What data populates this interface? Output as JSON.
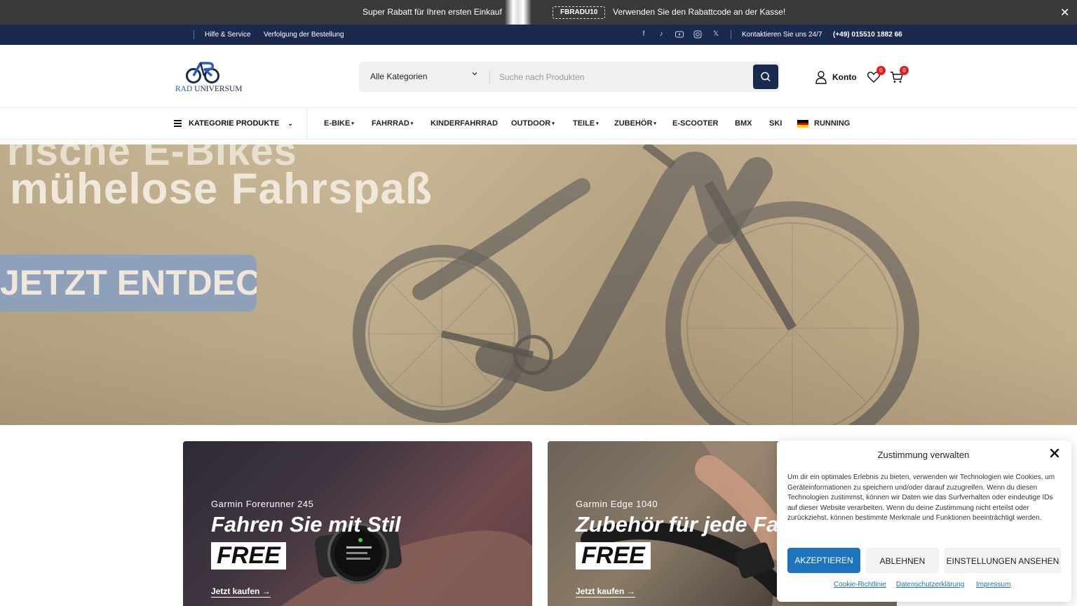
{
  "promo_bar": {
    "text_left": "Super Rabatt für Ihren ersten Einkauf",
    "code": "FBRADU10",
    "text_right": "Verwenden Sie den Rabattcode an der Kasse!",
    "close_icon": "close-icon"
  },
  "top_bar": {
    "links": [
      "Hilfe & Service",
      "Verfolgung der Bestellung"
    ],
    "social_icons": [
      "facebook-icon",
      "tiktok-icon",
      "youtube-icon",
      "instagram-icon",
      "x-icon"
    ],
    "contact_label": "Kontaktieren Sie uns 24/7",
    "phone": "(+49) 015510 1882 66"
  },
  "header": {
    "logo_text_1": "RAD",
    "logo_text_2": " UNIVERSUM",
    "search": {
      "category": "Alle Kategorien",
      "placeholder": "Suche nach Produkten",
      "button_icon": "search-icon"
    },
    "account_label": "Konto",
    "wishlist_count": "0",
    "cart_count": "0"
  },
  "nav": {
    "category_button": "KATEGORIE PRODUKTE",
    "items": [
      {
        "label": "E-BIKE",
        "dropdown": true
      },
      {
        "label": "FAHRRAD",
        "dropdown": true
      },
      {
        "label": "KINDERFAHRRAD",
        "dropdown": false
      },
      {
        "label": "OUTDOOR",
        "dropdown": true
      },
      {
        "label": "TEILE",
        "dropdown": true
      },
      {
        "label": "ZUBEHÖR",
        "dropdown": true
      },
      {
        "label": "E-SCOOTER",
        "dropdown": false
      },
      {
        "label": "BMX",
        "dropdown": false
      },
      {
        "label": "SKI",
        "dropdown": false
      },
      {
        "label": "RUNNING",
        "dropdown": false
      }
    ],
    "flag_colors": [
      "#000000",
      "#dd0000",
      "#ffce00"
    ]
  },
  "hero": {
    "cut_heading": "rische E-Bikes",
    "headline": "mühelose Fahrspaß",
    "cta": "JETZT ENTDECKEN"
  },
  "cards": [
    {
      "subtitle": "Garmin Forerunner 245",
      "title": "Fahren Sie mit Stil",
      "badge": "FREE",
      "link": "Jetzt kaufen →"
    },
    {
      "subtitle": "Garmin Edge 1040",
      "title": "Zubehör für jede Fahrt",
      "badge": "FREE",
      "link": "Jetzt kaufen →"
    }
  ],
  "cookie": {
    "title": "Zustimmung verwalten",
    "body": "Um dir ein optimales Erlebnis zu bieten, verwenden wir Technologien wie Cookies, um Geräteinformationen zu speichern und/oder darauf zuzugreifen. Wenn du diesen Technologien zustimmst, können wir Daten wie das Surfverhalten oder eindeutige IDs auf dieser Website verarbeiten. Wenn du deine Zustimmung nicht erteilst oder zurückziehst, können bestimmte Merkmale und Funktionen beeinträchtigt werden.",
    "accept": "AKZEPTIEREN",
    "deny": "ABLEHNEN",
    "preferences": "EINSTELLUNGEN ANSEHEN",
    "links": [
      "Cookie-Richtlinie",
      "Datenschutzerklärung",
      "Impressum"
    ]
  },
  "colors": {
    "navy": "#1a2a4f",
    "promo_bg": "#3a3a3a",
    "accent_blue": "#1e73be",
    "badge_red": "#e02020"
  }
}
